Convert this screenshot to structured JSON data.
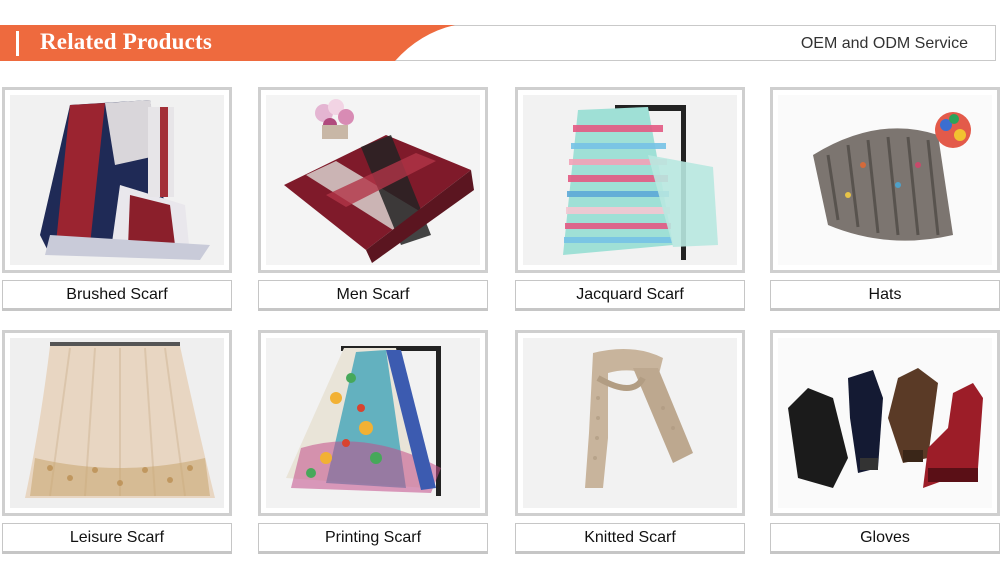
{
  "header": {
    "title": "Related Products",
    "right_text": "OEM and ODM Service",
    "accent_color": "#ee6a3e"
  },
  "products": [
    {
      "label": "Brushed Scarf",
      "icon": "brushed-scarf-image"
    },
    {
      "label": "Men Scarf",
      "icon": "men-scarf-image"
    },
    {
      "label": "Jacquard Scarf",
      "icon": "jacquard-scarf-image"
    },
    {
      "label": "Hats",
      "icon": "hat-image"
    },
    {
      "label": "Leisure Scarf",
      "icon": "leisure-scarf-image"
    },
    {
      "label": "Printing Scarf",
      "icon": "printing-scarf-image"
    },
    {
      "label": "Knitted Scarf",
      "icon": "knitted-scarf-image"
    },
    {
      "label": "Gloves",
      "icon": "gloves-image"
    }
  ]
}
